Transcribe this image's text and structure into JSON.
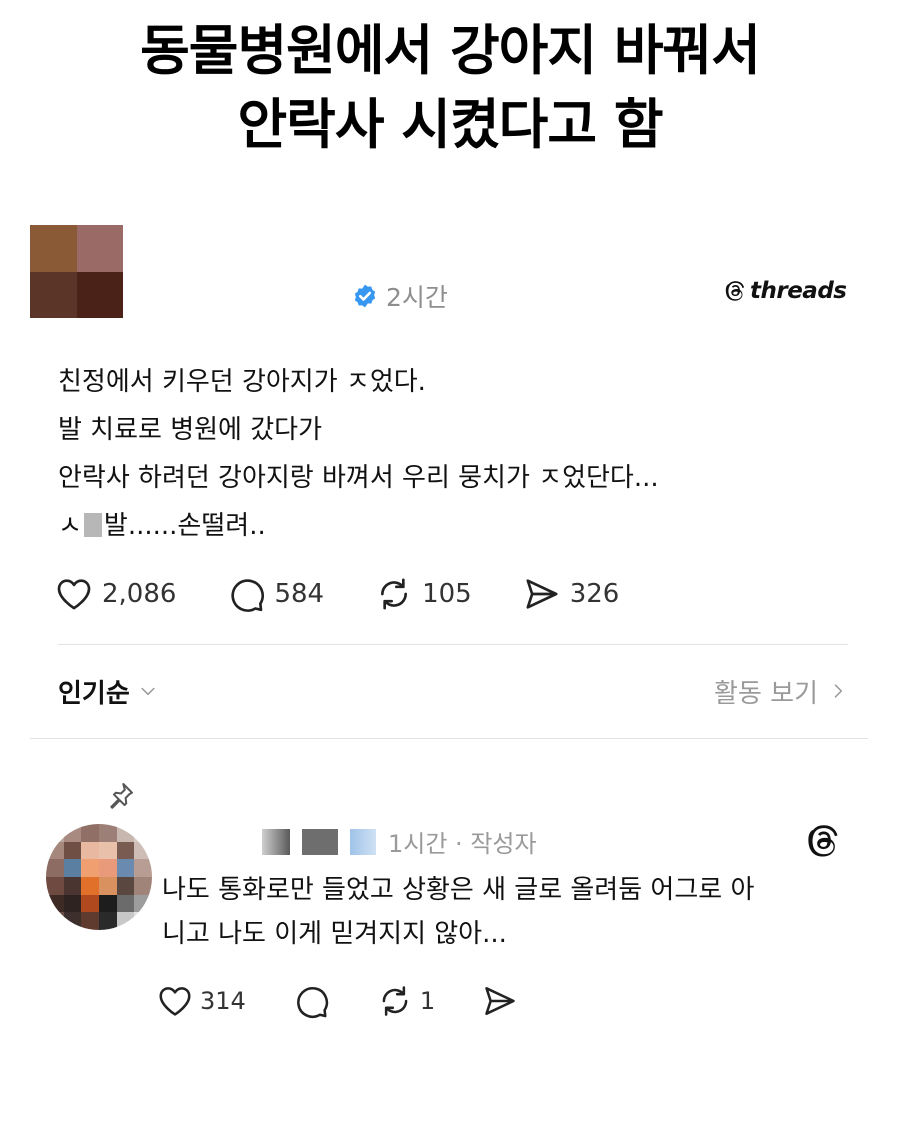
{
  "headline": {
    "line1": "동물병원에서 강아지 바꿔서",
    "line2": "안락사 시켰다고 함"
  },
  "post": {
    "timestamp": "2시간",
    "brand": "threads",
    "lines": [
      "친정에서 키우던 강아지가 ㅈ었다.",
      "발 치료로 병원에 갔다가",
      "안락사 하려던 강아지랑 바껴서 우리 뭉치가 ㅈ었단다..."
    ],
    "last_line_prefix": "ㅅ",
    "last_line_suffix": "발......손떨려..",
    "likes": "2,086",
    "comments": "584",
    "reposts": "105",
    "shares": "326"
  },
  "sort": {
    "label": "인기순",
    "activity_label": "활동 보기"
  },
  "reply": {
    "meta": "1시간 · 작성자",
    "lines": [
      "나도 통화로만 들었고 상황은 새 글로 올려둠 어그로 아",
      "니고 나도 이게 믿겨지지 않아..."
    ],
    "likes": "314",
    "reposts": "1"
  },
  "colors": {
    "verified": "#3897f0",
    "muted": "#9a9a9a",
    "text": "#111111"
  }
}
